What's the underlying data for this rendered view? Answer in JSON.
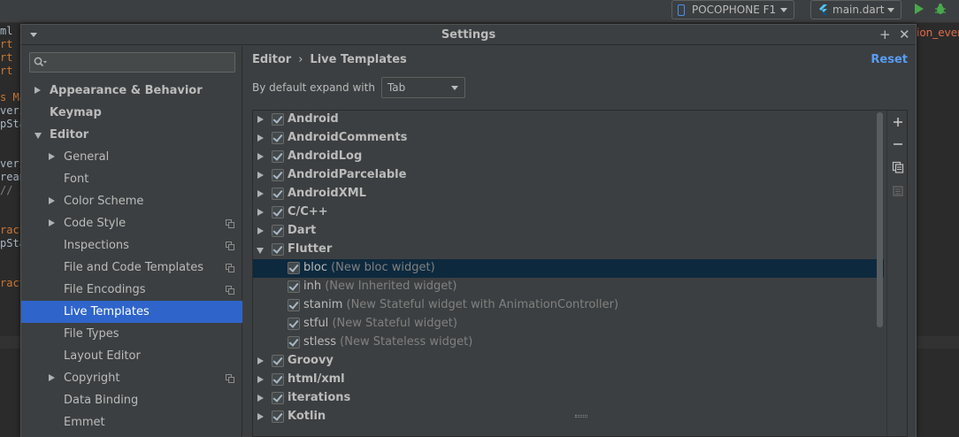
{
  "ide": {
    "device": "POCOPHONE F1",
    "run_file": "main.dart",
    "tab_fragment": "ion_ever",
    "gutter": [
      {
        "t": "ml",
        "c": "txt"
      },
      {
        "t": "rt",
        "c": "kw"
      },
      {
        "t": "rt",
        "c": "kw"
      },
      {
        "t": "rt",
        "c": "kw"
      },
      {
        "t": "",
        "c": "txt"
      },
      {
        "t": "s Ma",
        "c": "kw"
      },
      {
        "t": "veri",
        "c": "txt"
      },
      {
        "t": "pSta",
        "c": "txt"
      },
      {
        "t": "",
        "c": "txt"
      },
      {
        "t": "",
        "c": "txt"
      },
      {
        "t": "veri",
        "c": "txt"
      },
      {
        "t": "rean",
        "c": "txt"
      },
      {
        "t": "// i",
        "c": "cmt"
      },
      {
        "t": "",
        "c": "txt"
      },
      {
        "t": "",
        "c": "txt"
      },
      {
        "t": "ract",
        "c": "kw"
      },
      {
        "t": "pSta",
        "c": "txt"
      },
      {
        "t": "",
        "c": "txt"
      },
      {
        "t": "",
        "c": "txt"
      },
      {
        "t": "ract",
        "c": "kw"
      }
    ]
  },
  "dialog": {
    "title": "Settings",
    "search": {
      "placeholder": ""
    },
    "tree": [
      {
        "label": "Appearance & Behavior",
        "level": 0,
        "bold": true,
        "arrow": "right"
      },
      {
        "label": "Keymap",
        "level": 0,
        "bold": true,
        "arrow": "none"
      },
      {
        "label": "Editor",
        "level": 0,
        "bold": true,
        "arrow": "down"
      },
      {
        "label": "General",
        "level": 1,
        "arrow": "right"
      },
      {
        "label": "Font",
        "level": 1,
        "arrow": "none"
      },
      {
        "label": "Color Scheme",
        "level": 1,
        "arrow": "right"
      },
      {
        "label": "Code Style",
        "level": 1,
        "arrow": "right",
        "project_icon": true
      },
      {
        "label": "Inspections",
        "level": 1,
        "arrow": "none",
        "project_icon": true
      },
      {
        "label": "File and Code Templates",
        "level": 1,
        "arrow": "none",
        "project_icon": true
      },
      {
        "label": "File Encodings",
        "level": 1,
        "arrow": "none",
        "project_icon": true
      },
      {
        "label": "Live Templates",
        "level": 1,
        "arrow": "none",
        "selected": true
      },
      {
        "label": "File Types",
        "level": 1,
        "arrow": "none"
      },
      {
        "label": "Layout Editor",
        "level": 1,
        "arrow": "none"
      },
      {
        "label": "Copyright",
        "level": 1,
        "arrow": "right",
        "project_icon": true
      },
      {
        "label": "Data Binding",
        "level": 1,
        "arrow": "none"
      },
      {
        "label": "Emmet",
        "level": 1,
        "arrow": "none"
      }
    ],
    "breadcrumb": {
      "parent": "Editor",
      "separator": "›",
      "current": "Live Templates"
    },
    "reset_label": "Reset",
    "expand": {
      "label": "By default expand with",
      "value": "Tab"
    },
    "templates": [
      {
        "kind": "group",
        "name": "Android",
        "expanded": false,
        "checked": true
      },
      {
        "kind": "group",
        "name": "AndroidComments",
        "expanded": false,
        "checked": true
      },
      {
        "kind": "group",
        "name": "AndroidLog",
        "expanded": false,
        "checked": true
      },
      {
        "kind": "group",
        "name": "AndroidParcelable",
        "expanded": false,
        "checked": true
      },
      {
        "kind": "group",
        "name": "AndroidXML",
        "expanded": false,
        "checked": true
      },
      {
        "kind": "group",
        "name": "C/C++",
        "expanded": false,
        "checked": true
      },
      {
        "kind": "group",
        "name": "Dart",
        "expanded": false,
        "checked": true
      },
      {
        "kind": "group",
        "name": "Flutter",
        "expanded": true,
        "checked": true
      },
      {
        "kind": "item",
        "name": "bloc",
        "desc": "(New bloc widget)",
        "checked": true,
        "selected": true
      },
      {
        "kind": "item",
        "name": "inh",
        "desc": "(New Inherited widget)",
        "checked": true
      },
      {
        "kind": "item",
        "name": "stanim",
        "desc": "(New Stateful widget with AnimationController)",
        "checked": true
      },
      {
        "kind": "item",
        "name": "stful",
        "desc": "(New Stateful widget)",
        "checked": true
      },
      {
        "kind": "item",
        "name": "stless",
        "desc": "(New Stateless widget)",
        "checked": true
      },
      {
        "kind": "group",
        "name": "Groovy",
        "expanded": false,
        "checked": true
      },
      {
        "kind": "group",
        "name": "html/xml",
        "expanded": false,
        "checked": true
      },
      {
        "kind": "group",
        "name": "iterations",
        "expanded": false,
        "checked": true
      },
      {
        "kind": "group",
        "name": "Kotlin",
        "expanded": false,
        "checked": true
      }
    ],
    "tools": [
      "add-icon",
      "remove-icon",
      "copy-icon",
      "restore-icon"
    ]
  }
}
